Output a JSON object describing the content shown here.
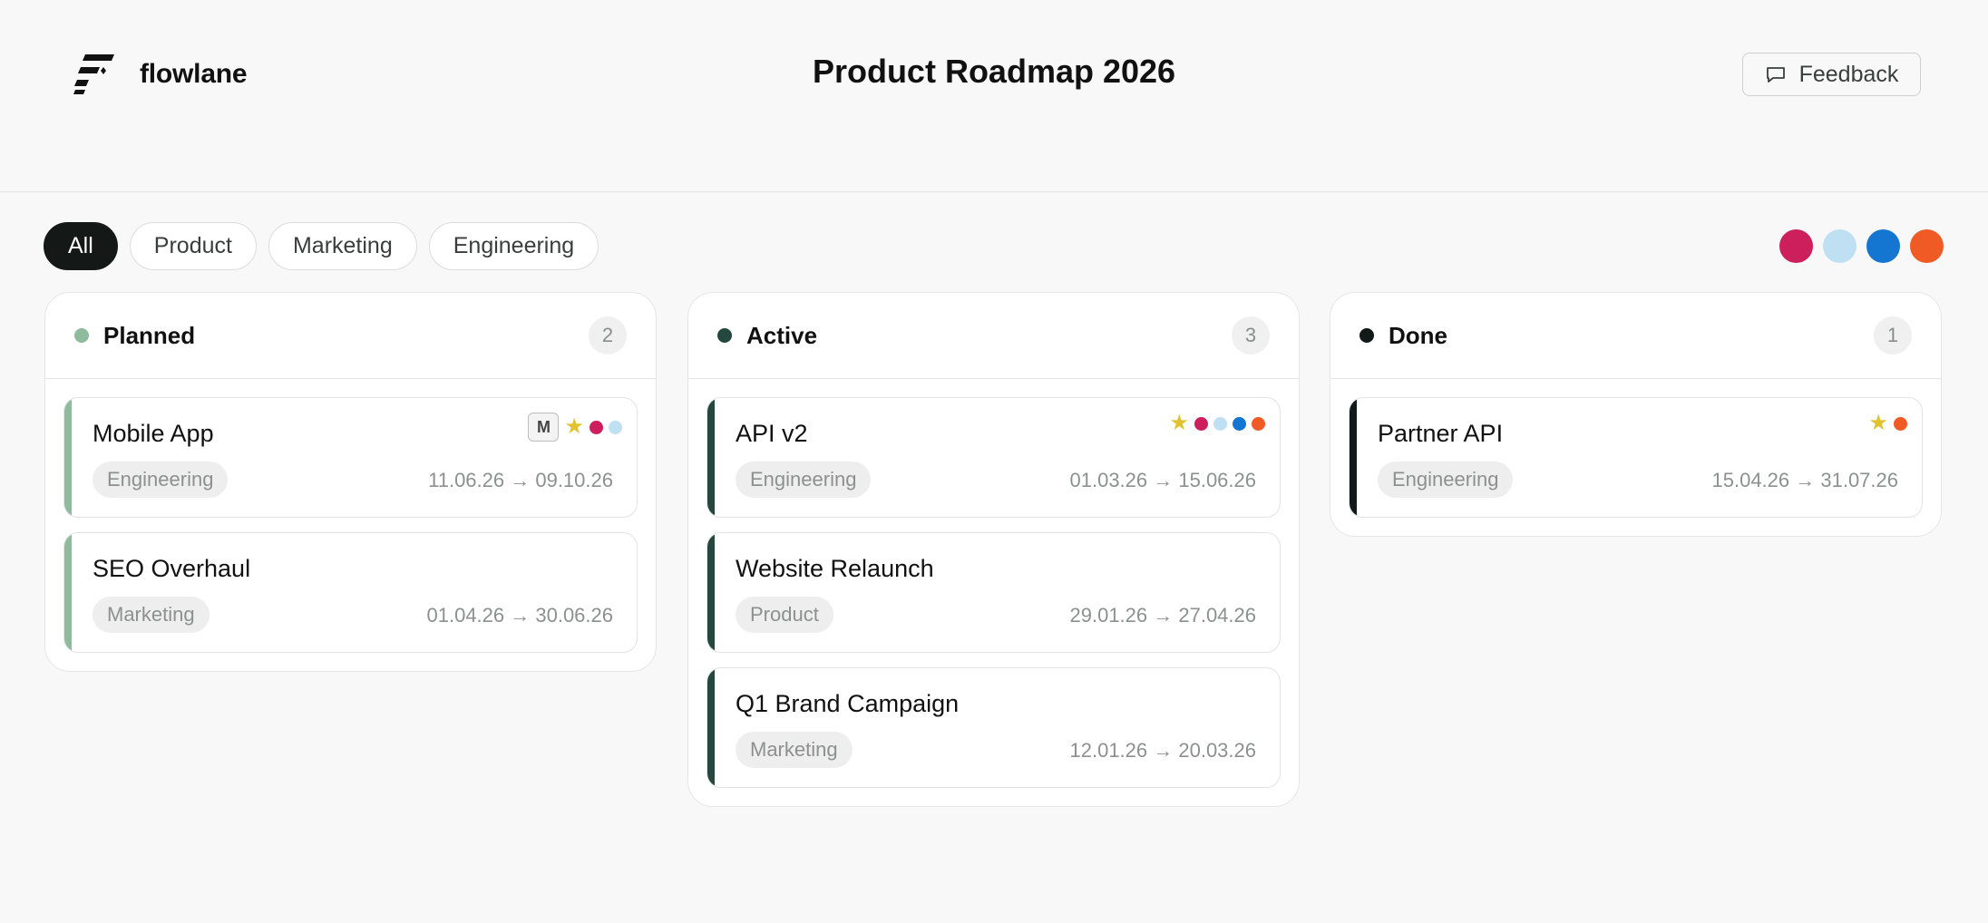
{
  "app": {
    "name": "flowlane"
  },
  "page": {
    "title": "Product Roadmap 2026"
  },
  "header": {
    "feedback_label": "Feedback"
  },
  "filters": [
    {
      "label": "All",
      "active": true
    },
    {
      "label": "Product",
      "active": false
    },
    {
      "label": "Marketing",
      "active": false
    },
    {
      "label": "Engineering",
      "active": false
    }
  ],
  "swatches": [
    "#cc1f5b",
    "#bfe0f2",
    "#1576d1",
    "#f05a24"
  ],
  "columns": [
    {
      "title": "Planned",
      "count": "2",
      "color": "#8dbb9c",
      "cards": [
        {
          "title": "Mobile App",
          "tag": "Engineering",
          "dates": "11.06.26 → 09.10.26",
          "markers": {
            "letter": "M",
            "star": true,
            "dots": [
              "#cc1f5b",
              "#bfe0f2"
            ]
          }
        },
        {
          "title": "SEO Overhaul",
          "tag": "Marketing",
          "dates": "01.04.26 → 30.06.26",
          "markers": {
            "letter": "",
            "star": false,
            "dots": []
          }
        }
      ]
    },
    {
      "title": "Active",
      "count": "3",
      "color": "#24483e",
      "cards": [
        {
          "title": "API v2",
          "tag": "Engineering",
          "dates": "01.03.26 → 15.06.26",
          "markers": {
            "letter": "",
            "star": true,
            "dots": [
              "#cc1f5b",
              "#bfe0f2",
              "#1576d1",
              "#f05a24"
            ]
          }
        },
        {
          "title": "Website Relaunch",
          "tag": "Product",
          "dates": "29.01.26 → 27.04.26",
          "markers": {
            "letter": "",
            "star": false,
            "dots": []
          }
        },
        {
          "title": "Q1 Brand Campaign",
          "tag": "Marketing",
          "dates": "12.01.26 → 20.03.26",
          "markers": {
            "letter": "",
            "star": false,
            "dots": []
          }
        }
      ]
    },
    {
      "title": "Done",
      "count": "1",
      "color": "#111a18",
      "cards": [
        {
          "title": "Partner API",
          "tag": "Engineering",
          "dates": "15.04.26 → 31.07.26",
          "markers": {
            "letter": "",
            "star": true,
            "dots": [
              "#f05a24"
            ]
          }
        }
      ]
    }
  ]
}
